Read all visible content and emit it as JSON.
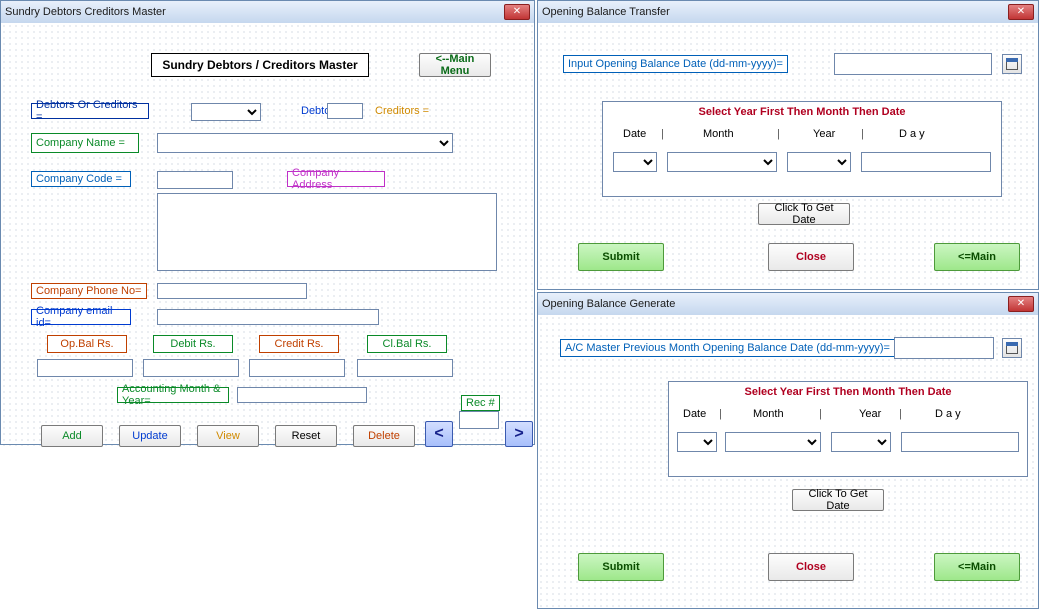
{
  "winA": {
    "title": "Sundry Debtors Creditors Master",
    "header": "Sundry Debtors / Creditors Master",
    "main_menu": "<--Main Menu",
    "labels": {
      "deb_or_cred": "Debtors Or Creditors =",
      "debtors": "Debtors =",
      "creditors": "Creditors =",
      "company_name": "Company Name  =",
      "company_code": "Company Code   =",
      "company_addr": "Company Address",
      "company_phone": "Company Phone No=",
      "company_email": "Company email id=",
      "op_bal": "Op.Bal Rs.",
      "debit": "Debit Rs.",
      "credit": "Credit Rs.",
      "cl_bal": "Cl.Bal Rs.",
      "acct_month_year": "Accounting Month & Year=",
      "rec_no": "Rec #"
    },
    "values": {
      "deb_or_cred": "",
      "debtors": "",
      "company_name": "",
      "company_code": "",
      "company_addr": "",
      "company_phone": "",
      "company_email": "",
      "op_bal": "",
      "debit": "",
      "credit": "",
      "cl_bal": "",
      "acct_month_year": "",
      "rec_no": ""
    },
    "buttons": {
      "add": "Add",
      "update": "Update",
      "view": "View",
      "reset": "Reset",
      "delete": "Delete",
      "prev": "<",
      "next": ">"
    }
  },
  "winB": {
    "title": "Opening Balance Transfer",
    "prompt": "Input Opening Balance Date (dd-mm-yyyy)=",
    "date_value": "",
    "frame_title": "Select Year First Then Month Then Date",
    "hdr": {
      "date": "Date",
      "month": "Month",
      "year": "Year",
      "day": "D a y"
    },
    "click": "Click To Get Date",
    "submit": "Submit",
    "close": "Close",
    "main": "<=Main"
  },
  "winC": {
    "title": "Opening Balance Generate",
    "prompt": "A/C Master Previous Month Opening Balance Date (dd-mm-yyyy)=",
    "date_value": "",
    "frame_title": "Select Year First Then Month Then Date",
    "hdr": {
      "date": "Date",
      "month": "Month",
      "year": "Year",
      "day": "D a y"
    },
    "click": "Click To Get Date",
    "submit": "Submit",
    "close": "Close",
    "main": "<=Main"
  }
}
